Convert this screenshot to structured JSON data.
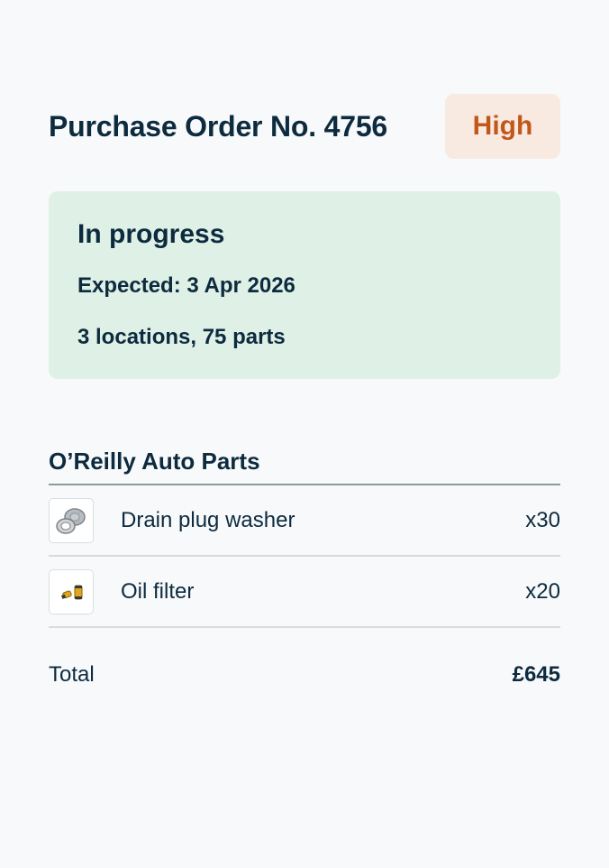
{
  "order": {
    "title": "Purchase Order No. 4756",
    "priority": "High"
  },
  "status": {
    "title": "In progress",
    "expected": "Expected: 3 Apr 2026",
    "summary": "3 locations, 75 parts"
  },
  "supplier": {
    "name": "O’Reilly Auto Parts",
    "items": [
      {
        "name": "Drain plug washer",
        "qty": "x30",
        "icon": "washer-icon"
      },
      {
        "name": "Oil filter",
        "qty": "x20",
        "icon": "oil-filter-icon"
      }
    ]
  },
  "total": {
    "label": "Total",
    "value": "£645"
  },
  "colors": {
    "background": "#f7f9fb",
    "text": "#0d2b3e",
    "priority_bg": "#f8e9e1",
    "priority_text": "#c2571a",
    "status_bg": "#dff0e6"
  }
}
